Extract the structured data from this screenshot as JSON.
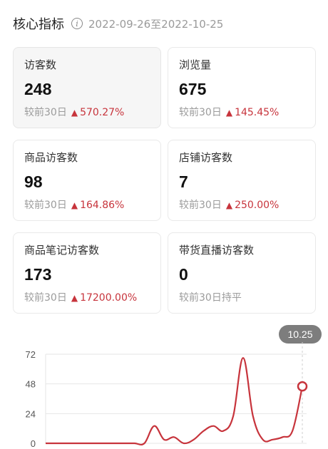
{
  "header": {
    "title": "核心指标",
    "info_icon": "info-icon",
    "date_range": "2022-09-26至2022-10-25"
  },
  "metrics": [
    {
      "label": "访客数",
      "value": "248",
      "compare": "较前30日",
      "change": "570.27%",
      "trend": "up",
      "active": true
    },
    {
      "label": "浏览量",
      "value": "675",
      "compare": "较前30日",
      "change": "145.45%",
      "trend": "up"
    },
    {
      "label": "商品访客数",
      "value": "98",
      "compare": "较前30日",
      "change": "164.86%",
      "trend": "up"
    },
    {
      "label": "店铺访客数",
      "value": "7",
      "compare": "较前30日",
      "change": "250.00%",
      "trend": "up"
    },
    {
      "label": "商品笔记访客数",
      "value": "173",
      "compare": "较前30日",
      "change": "17200.00%",
      "trend": "up"
    },
    {
      "label": "带货直播访客数",
      "value": "0",
      "compare": "较前30日持平",
      "change": "",
      "trend": "flat"
    }
  ],
  "colors": {
    "accent": "#c7343c",
    "muted": "#9b9b9b"
  },
  "tooltip": {
    "label": "10.25"
  },
  "chart_data": {
    "type": "line",
    "title": "",
    "xlabel": "",
    "ylabel": "",
    "ylim": [
      0,
      72
    ],
    "yticks": [
      "72",
      "48",
      "24",
      "0"
    ],
    "highlight_label": "10.25",
    "series": [
      {
        "values": [
          0,
          0,
          0,
          0,
          0,
          0,
          0,
          0,
          0,
          0,
          0,
          14,
          3,
          5,
          0,
          3,
          10,
          14,
          10,
          22,
          69,
          22,
          3,
          3,
          5,
          10,
          46
        ]
      }
    ]
  }
}
